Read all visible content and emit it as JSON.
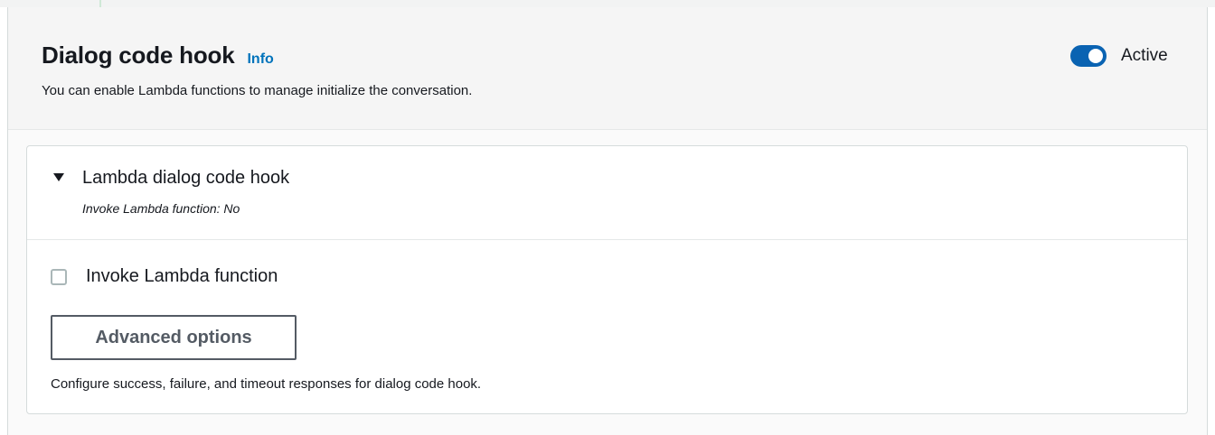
{
  "header": {
    "title": "Dialog code hook",
    "info_link": "Info",
    "description": "You can enable Lambda functions to manage initialize the conversation.",
    "toggle_label": "Active",
    "toggle_on": true
  },
  "lambda_section": {
    "title": "Lambda dialog code hook",
    "subtitle": "Invoke Lambda function: No",
    "expanded": true,
    "checkbox_label": "Invoke Lambda function",
    "checkbox_checked": false,
    "advanced_button": "Advanced options",
    "hint": "Configure success, failure, and timeout responses for dialog code hook."
  },
  "colors": {
    "accent": "#0a63b2",
    "link": "#0073bb",
    "text": "#16191f",
    "border": "#d5dbdb"
  }
}
